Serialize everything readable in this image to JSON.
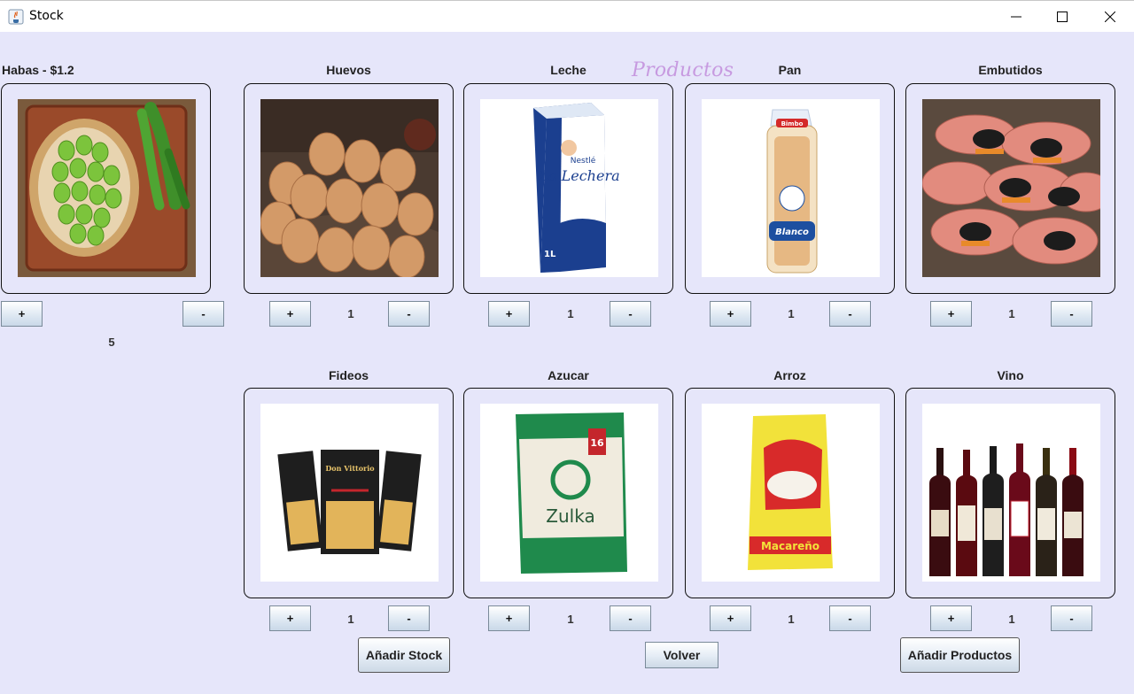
{
  "window": {
    "title": "Stock",
    "icon": "java-app-icon"
  },
  "heading": "Productos",
  "products": [
    {
      "name": "Habas - $1.2",
      "count": "5",
      "image": "fava-beans-image"
    },
    {
      "name": "Huevos",
      "count": "1",
      "image": "eggs-image"
    },
    {
      "name": "Leche",
      "count": "1",
      "image": "milk-carton-image"
    },
    {
      "name": "Pan",
      "count": "1",
      "image": "bread-loaf-image"
    },
    {
      "name": "Embutidos",
      "count": "1",
      "image": "sausages-image"
    },
    {
      "name": "Fideos",
      "count": "1",
      "image": "pasta-packs-image"
    },
    {
      "name": "Azucar",
      "count": "1",
      "image": "sugar-bag-image"
    },
    {
      "name": "Arroz",
      "count": "1",
      "image": "rice-bag-image"
    },
    {
      "name": "Vino",
      "count": "1",
      "image": "wine-bottles-image"
    }
  ],
  "controls": {
    "plus": "+",
    "minus": "-"
  },
  "actions": {
    "add_stock": "Añadir Stock",
    "back": "Volver",
    "add_products": "Añadir Productos"
  },
  "image_texts": {
    "milk_brand": "La Lechera",
    "milk_maker": "Nestlé",
    "milk_volume": "1L",
    "bread_brand": "Bimbo",
    "bread_variety": "Blanco",
    "pasta_brand": "Don Vittorio",
    "sugar_brand": "Zulka",
    "rice_brand": "Macareño",
    "sugar_badge": "16"
  },
  "colors": {
    "background": "#e6e6fa",
    "heading": "#c79ae0"
  }
}
